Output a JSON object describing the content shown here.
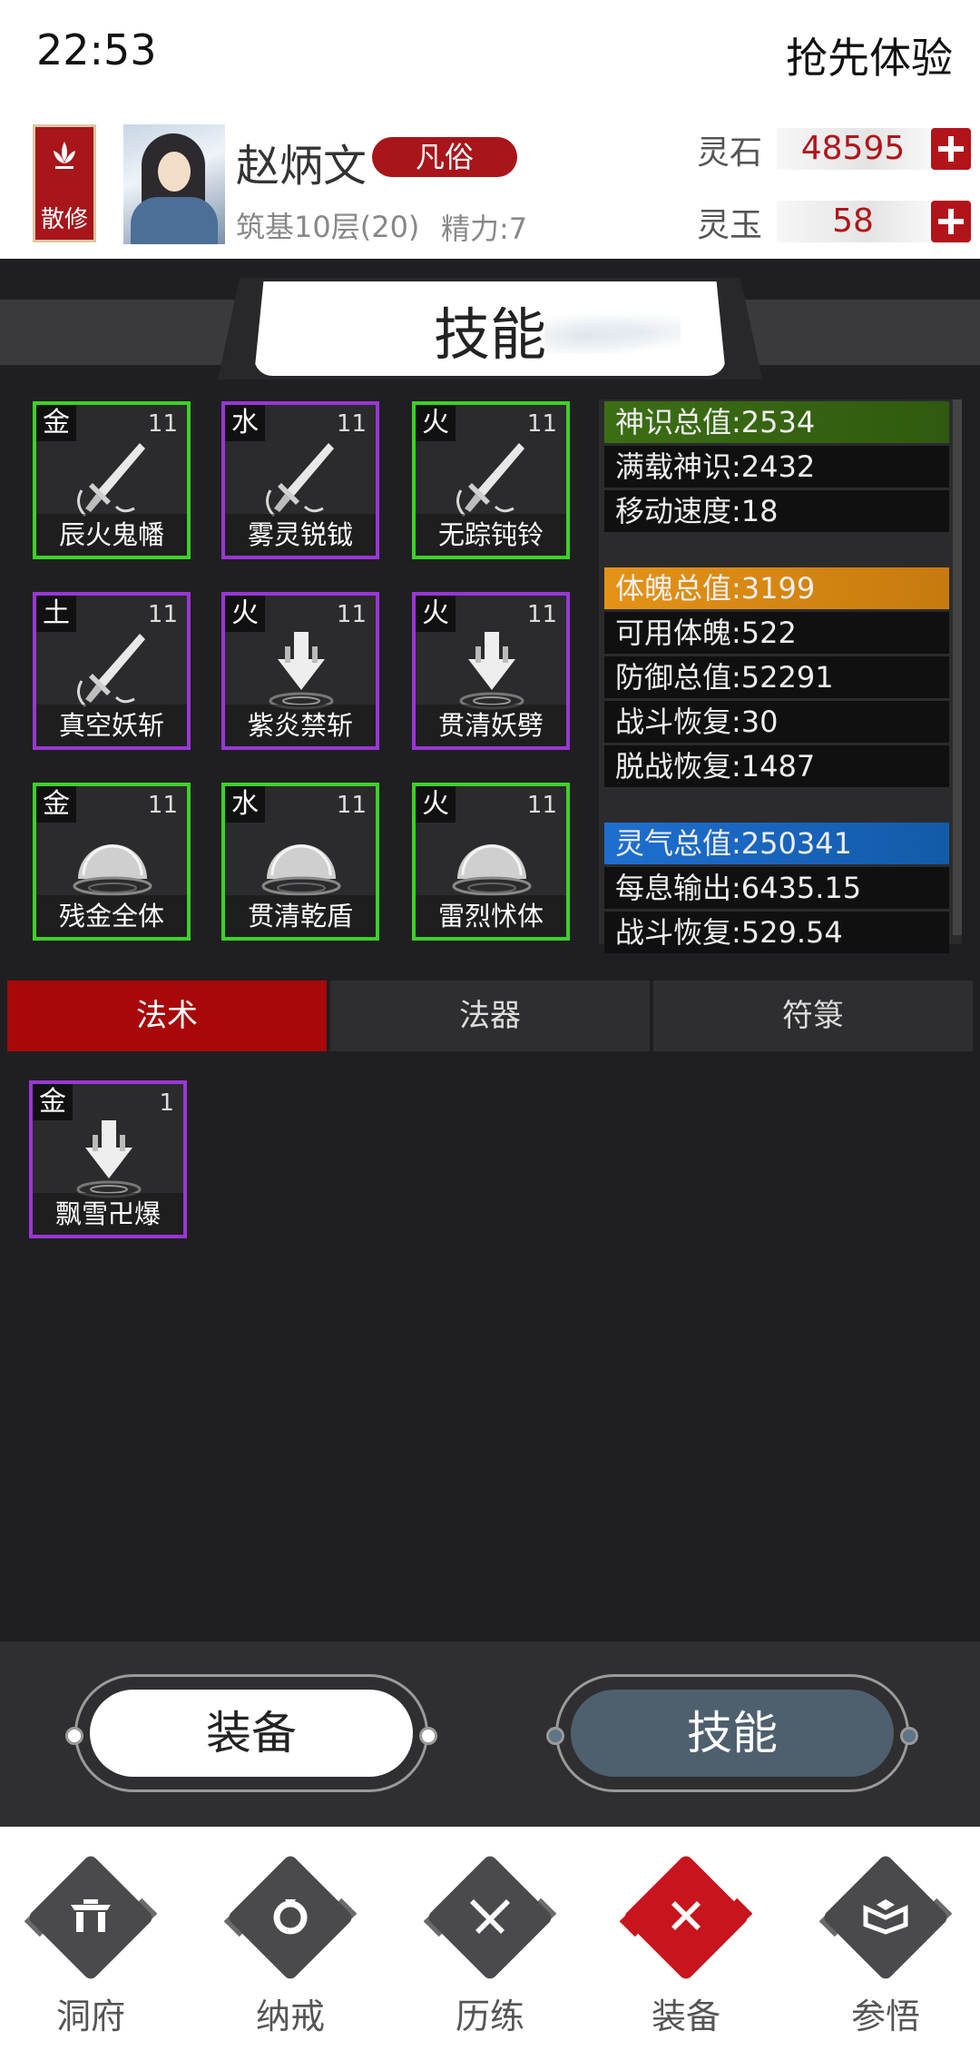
{
  "status_bar": {
    "time": "22:53",
    "right_text": "抢先体验"
  },
  "profile": {
    "sect": "散修",
    "name": "赵炳文",
    "rank": "凡俗",
    "realm": "筑基10层(20)",
    "energy": "精力:7",
    "currencies": [
      {
        "label": "灵石",
        "value": "48595"
      },
      {
        "label": "灵玉",
        "value": "58"
      }
    ]
  },
  "page_title": "技能",
  "skills": [
    {
      "element": "金",
      "level": "11",
      "name": "辰火鬼幡",
      "frame": "green",
      "icon": "sword-icon"
    },
    {
      "element": "水",
      "level": "11",
      "name": "雾灵锐钺",
      "frame": "purple",
      "icon": "sword-icon"
    },
    {
      "element": "火",
      "level": "11",
      "name": "无踪钝铃",
      "frame": "green",
      "icon": "sword-icon"
    },
    {
      "element": "土",
      "level": "11",
      "name": "真空妖斩",
      "frame": "purple",
      "icon": "sword-icon"
    },
    {
      "element": "火",
      "level": "11",
      "name": "紫炎禁斩",
      "frame": "purple",
      "icon": "down-arrow-strike-icon"
    },
    {
      "element": "火",
      "level": "11",
      "name": "贯清妖劈",
      "frame": "purple",
      "icon": "down-arrow-strike-icon"
    },
    {
      "element": "金",
      "level": "11",
      "name": "残金全体",
      "frame": "green",
      "icon": "dome-shield-icon"
    },
    {
      "element": "水",
      "level": "11",
      "name": "贯清乾盾",
      "frame": "green",
      "icon": "dome-shield-icon"
    },
    {
      "element": "火",
      "level": "11",
      "name": "雷烈怵体",
      "frame": "green",
      "icon": "dome-shield-icon"
    }
  ],
  "stats": [
    {
      "label": "神识总值:",
      "value": "2534",
      "style": "head-green"
    },
    {
      "label": "满载神识:",
      "value": "2432",
      "style": ""
    },
    {
      "label": "移动速度:",
      "value": "18",
      "style": ""
    },
    {
      "label": "体魄总值:",
      "value": "3199",
      "style": "head-orange"
    },
    {
      "label": "可用体魄:",
      "value": "522",
      "style": ""
    },
    {
      "label": "防御总值:",
      "value": "52291",
      "style": ""
    },
    {
      "label": "战斗恢复:",
      "value": "30",
      "style": ""
    },
    {
      "label": "脱战恢复:",
      "value": "1487",
      "style": ""
    },
    {
      "label": "灵气总值:",
      "value": "250341",
      "style": "head-blue"
    },
    {
      "label": "每息输出:",
      "value": "6435.15",
      "style": ""
    },
    {
      "label": "战斗恢复:",
      "value": "529.54",
      "style": ""
    }
  ],
  "tabs": [
    {
      "label": "法术",
      "active": true
    },
    {
      "label": "法器",
      "active": false
    },
    {
      "label": "符箓",
      "active": false
    }
  ],
  "spells": [
    {
      "element": "金",
      "level": "1",
      "name": "飘雪卍爆",
      "frame": "purple",
      "icon": "down-arrow-strike-icon"
    }
  ],
  "actions": {
    "equip": "装备",
    "skill": "技能"
  },
  "nav": [
    {
      "label": "洞府",
      "icon": "gate-icon",
      "active": false
    },
    {
      "label": "纳戒",
      "icon": "ring-icon",
      "active": false
    },
    {
      "label": "历练",
      "icon": "crossed-swords-icon",
      "active": false
    },
    {
      "label": "装备",
      "icon": "cross-icon",
      "active": true
    },
    {
      "label": "参悟",
      "icon": "book-icon",
      "active": false
    }
  ],
  "colors": {
    "accent_red": "#a8080a",
    "frame_green": "#3cd226",
    "frame_purple": "#9a36d6",
    "stat_green": "#3c6e14",
    "stat_orange": "#e49317",
    "stat_blue": "#1e6fd0"
  }
}
